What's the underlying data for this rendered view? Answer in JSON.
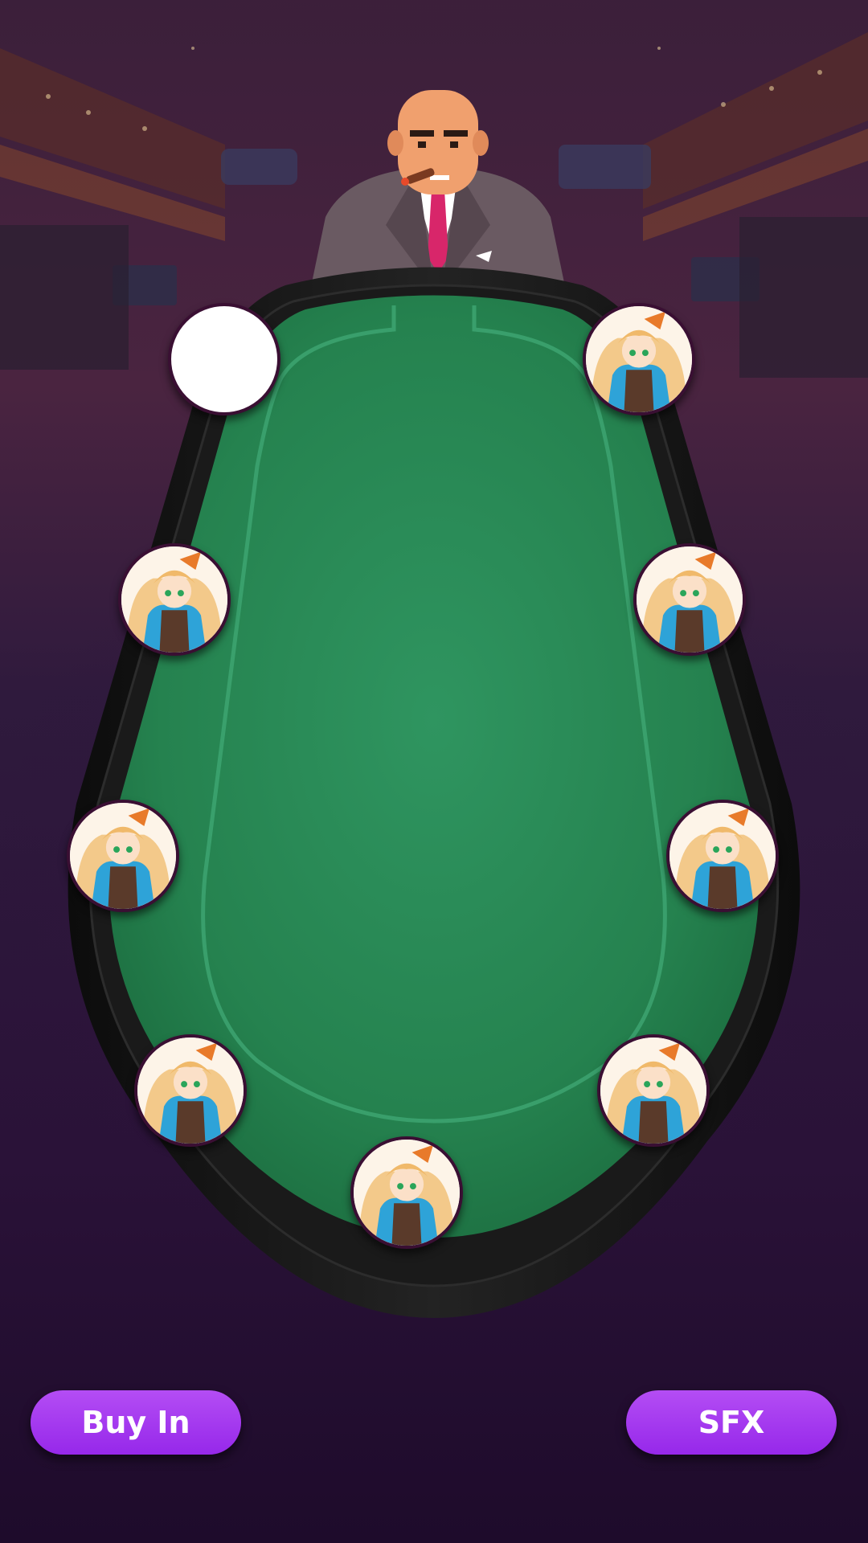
{
  "buttons": {
    "buy_in_label": "Buy In",
    "sfx_label": "SFX"
  },
  "seats": [
    {
      "position": "top-left",
      "occupied": false,
      "avatar": "empty-seat"
    },
    {
      "position": "top-right",
      "occupied": true,
      "avatar": "anime-girl-avatar"
    },
    {
      "position": "upper-left",
      "occupied": true,
      "avatar": "anime-girl-avatar"
    },
    {
      "position": "upper-right",
      "occupied": true,
      "avatar": "anime-girl-avatar"
    },
    {
      "position": "middle-left",
      "occupied": true,
      "avatar": "anime-girl-avatar"
    },
    {
      "position": "middle-right",
      "occupied": true,
      "avatar": "anime-girl-avatar"
    },
    {
      "position": "lower-left",
      "occupied": true,
      "avatar": "anime-girl-avatar"
    },
    {
      "position": "lower-right",
      "occupied": true,
      "avatar": "anime-girl-avatar"
    },
    {
      "position": "bottom-center",
      "occupied": true,
      "avatar": "anime-girl-avatar"
    }
  ],
  "dealer": {
    "icon": "dealer-icon"
  },
  "colors": {
    "felt": "#2a8a56",
    "rail": "#161616",
    "button": "#a23bf0",
    "seat_border": "#3a0f33",
    "background": "#2a1238"
  }
}
